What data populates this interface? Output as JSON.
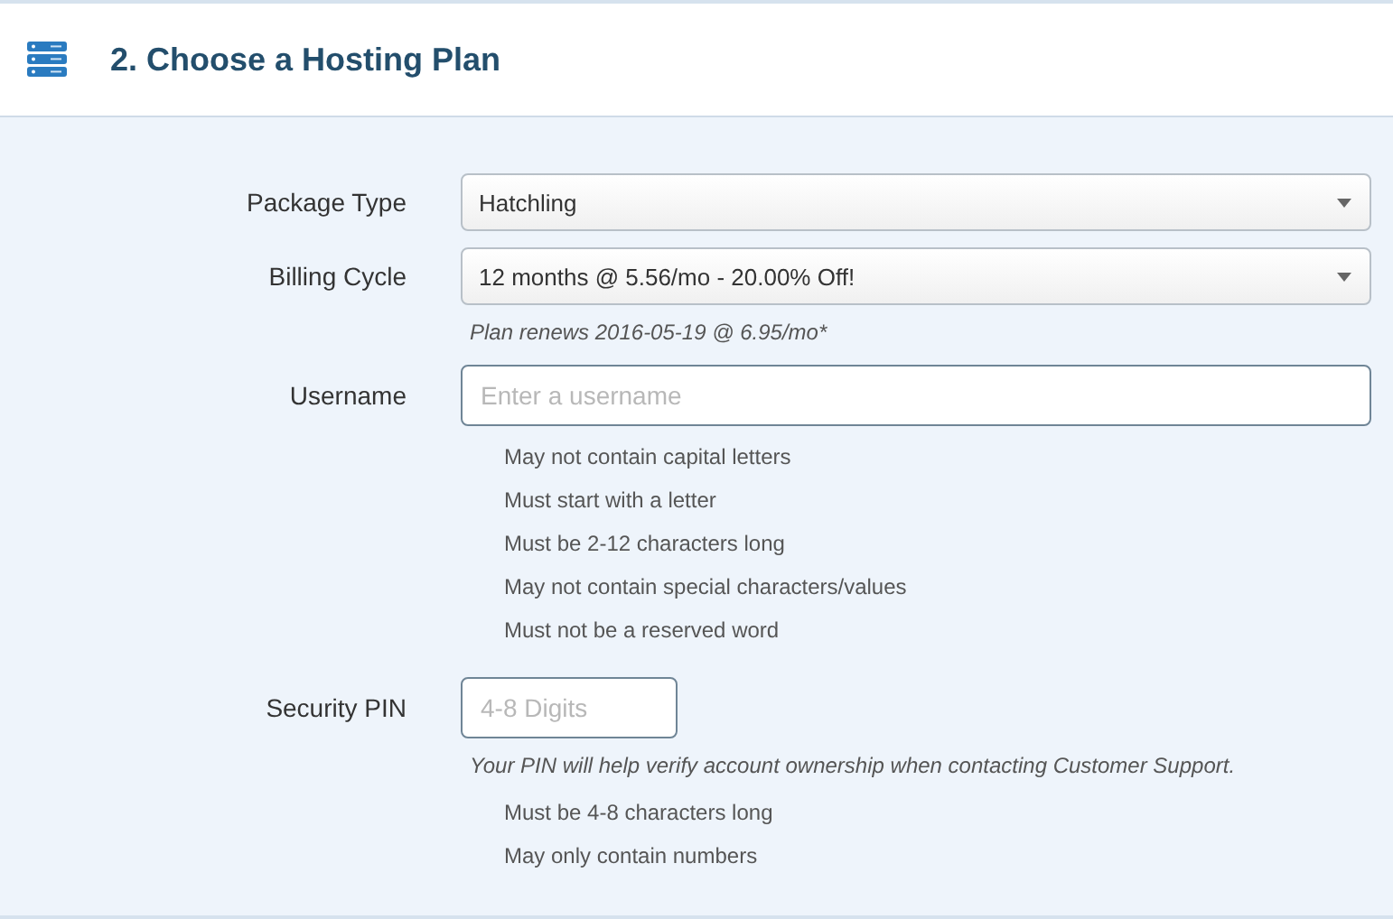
{
  "header": {
    "title": "2. Choose a Hosting Plan"
  },
  "fields": [
    {
      "kind": "select",
      "label": "Package Type",
      "value": "Hatchling"
    },
    {
      "kind": "select",
      "label": "Billing Cycle",
      "value": "12 months @ 5.56/mo - 20.00% Off!",
      "note": "Plan renews 2016-05-19 @ 6.95/mo*"
    },
    {
      "kind": "text",
      "label": "Username",
      "placeholder": "Enter a username",
      "rules": [
        "May not contain capital letters",
        "Must start with a letter",
        "Must be 2-12 characters long",
        "May not contain special characters/values",
        "Must not be a reserved word"
      ]
    },
    {
      "kind": "short",
      "label": "Security PIN",
      "placeholder": "4-8 Digits",
      "note": "Your PIN will help verify account ownership when contacting Customer Support.",
      "rules": [
        "Must be 4-8 characters long",
        "May only contain numbers"
      ]
    }
  ]
}
